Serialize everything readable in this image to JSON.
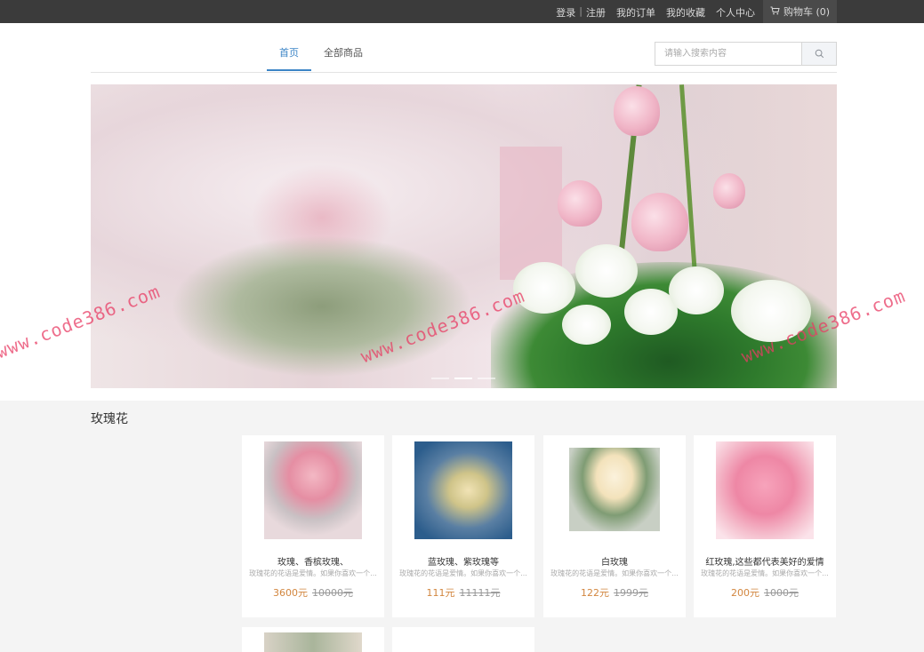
{
  "topbar": {
    "login": "登录",
    "separator": "|",
    "register": "注册",
    "my_orders": "我的订单",
    "my_favorites": "我的收藏",
    "user_center": "个人中心",
    "cart_label": "购物车 (0)"
  },
  "nav": {
    "tabs": [
      {
        "label": "首页",
        "active": true
      },
      {
        "label": "全部商品",
        "active": false
      }
    ]
  },
  "search": {
    "placeholder": "请输入搜索内容",
    "icon": "search-icon"
  },
  "banner": {
    "slides": 3,
    "active_slide": 1
  },
  "watermark": "www.code386.com",
  "section": {
    "title": "玫瑰花"
  },
  "products": [
    {
      "name": "玫瑰、香槟玫瑰、",
      "desc": "玫瑰花的花语是爱情。如果你喜欢一个...",
      "price": "3600元",
      "old_price": "10000元"
    },
    {
      "name": "蓝玫瑰、紫玫瑰等",
      "desc": "玫瑰花的花语是爱情。如果你喜欢一个...",
      "price": "111元",
      "old_price": "11111元"
    },
    {
      "name": "白玫瑰",
      "desc": "玫瑰花的花语是爱情。如果你喜欢一个...",
      "price": "122元",
      "old_price": "1999元"
    },
    {
      "name": "红玫瑰,这些都代表美好的爱情",
      "desc": "玫瑰花的花语是爱情。如果你喜欢一个...",
      "price": "200元",
      "old_price": "1000元"
    }
  ],
  "colors": {
    "accent": "#3c85c6",
    "price": "#d2863f",
    "topbar": "#3b3b3b",
    "watermark": "#e83c64"
  }
}
